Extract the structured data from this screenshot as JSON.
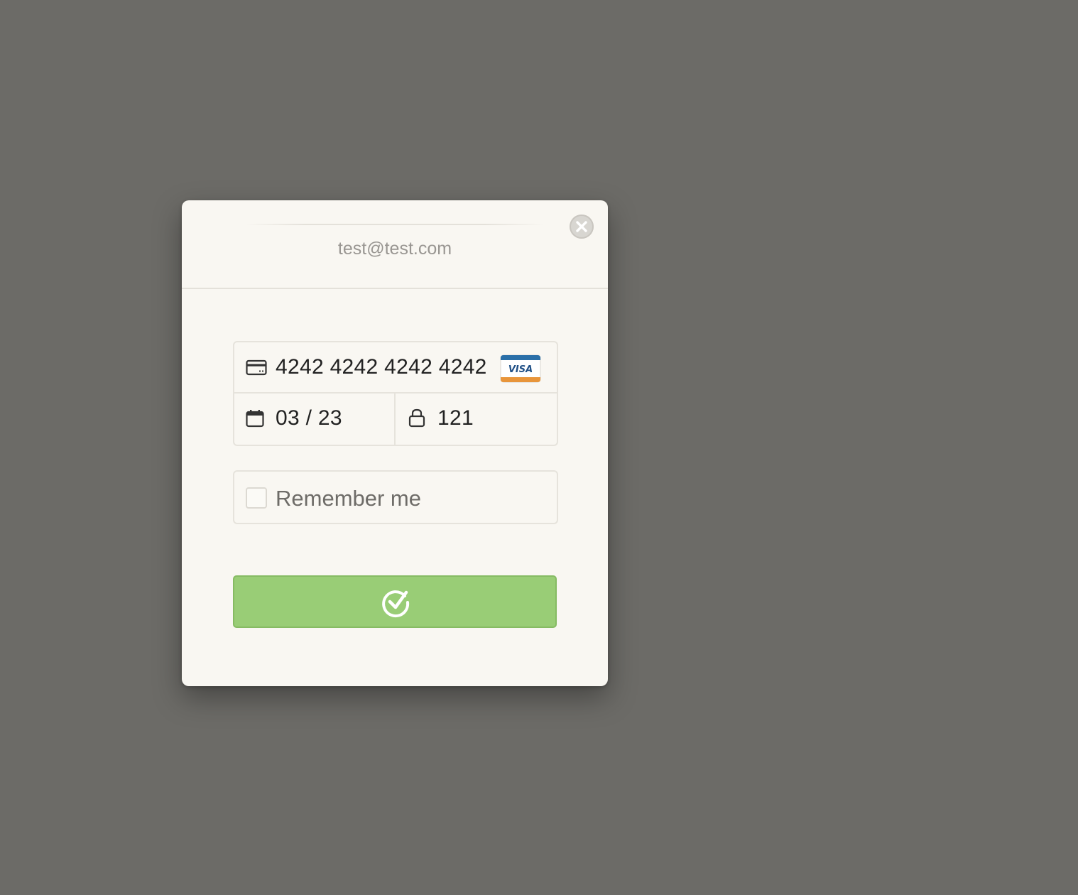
{
  "header": {
    "email": "test@test.com"
  },
  "card": {
    "number": "4242 4242 4242 4242",
    "brand": "VISA",
    "expiry": "03 / 23",
    "cvc": "121"
  },
  "remember": {
    "label": "Remember me",
    "checked": false
  },
  "icons": {
    "close": "close-icon",
    "card": "credit-card-icon",
    "calendar": "calendar-icon",
    "lock": "lock-icon",
    "submit": "checkmark-circle-icon"
  },
  "colors": {
    "background": "#6c6b67",
    "modal": "#f9f7f2",
    "submit": "#99cd76",
    "visa_blue": "#2a6fa8",
    "visa_orange": "#e8953a"
  }
}
